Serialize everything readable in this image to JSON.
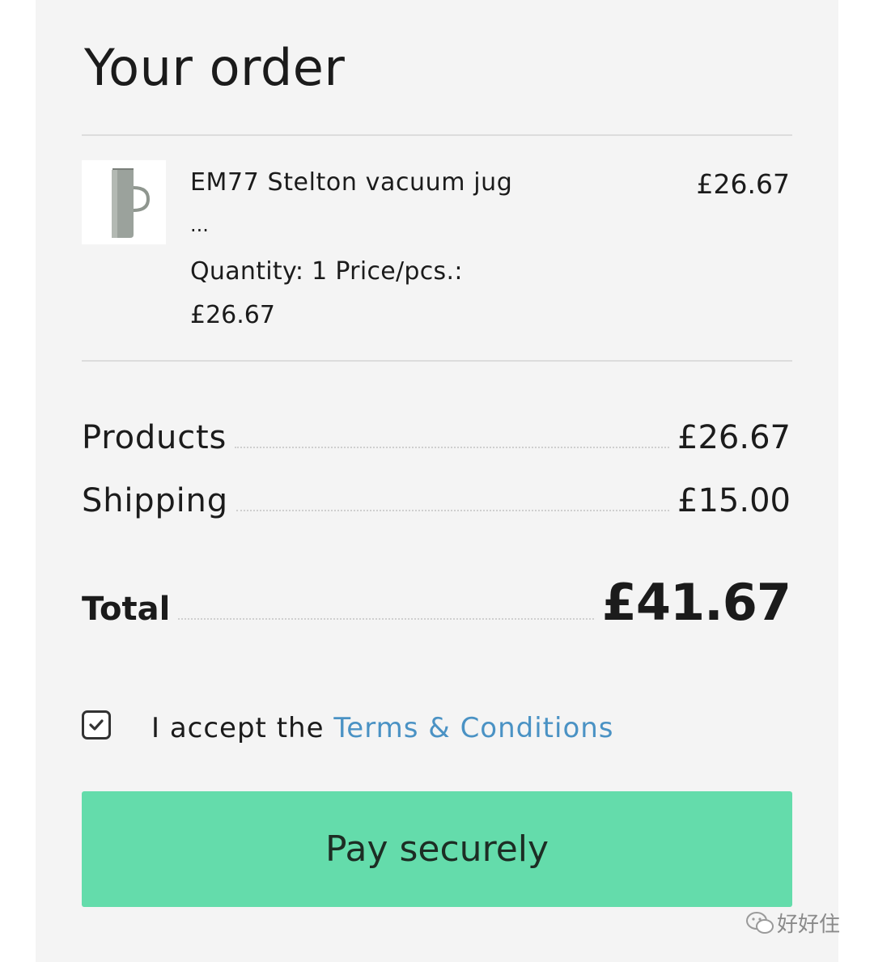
{
  "header": {
    "title": "Your order"
  },
  "item": {
    "name": "EM77 Stelton vacuum jug",
    "ellipsis": "...",
    "quantity_line": "Quantity: 1 Price/pcs.:",
    "unit_price": "£26.67",
    "line_price": "£26.67",
    "image_icon": "jug-product-image"
  },
  "summary": {
    "products_label": "Products",
    "products_value": "£26.67",
    "shipping_label": "Shipping",
    "shipping_value": "£15.00",
    "total_label": "Total",
    "total_value": "£41.67"
  },
  "terms": {
    "checked": true,
    "prefix": "I accept the ",
    "link_label": "Terms & Conditions"
  },
  "pay": {
    "label": "Pay securely"
  },
  "watermark": {
    "text": "好好住",
    "icon": "wechat-icon"
  },
  "colors": {
    "accent_button": "#64dcab",
    "link": "#4a92c4",
    "panel_bg": "#f4f4f4"
  }
}
